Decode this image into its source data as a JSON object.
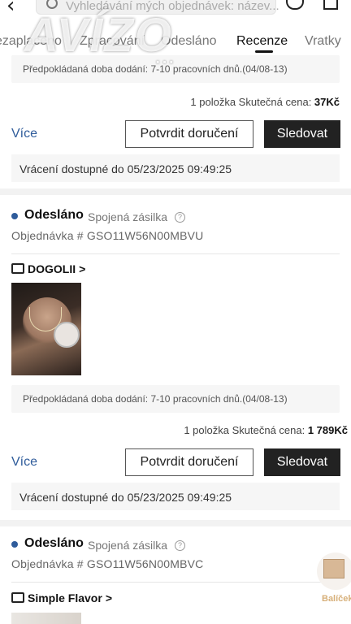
{
  "search": {
    "placeholder": "Vyhledávání mých objednávek: název..."
  },
  "watermark": {
    "text": "AVÍZO",
    "dots": "..."
  },
  "tabs": [
    {
      "label": "ezaplaceno"
    },
    {
      "label": "Zpracování"
    },
    {
      "label": "Odesláno"
    },
    {
      "label": "Recenze"
    },
    {
      "label": "Vratky"
    }
  ],
  "orders": [
    {
      "eta": "Předpokládaná doba dodání: 7-10 pracovních dnů.(04/08-13)",
      "summary_prefix": "1 položka Skutečná cena: ",
      "price": "37Kč",
      "more": "Více",
      "confirm": "Potvrdit doručení",
      "track": "Sledovat",
      "return_note": "Vrácení dostupné do 05/23/2025 09:49:25"
    },
    {
      "status": "Odesláno",
      "combined": "Spojená zásilka",
      "order_no": "Objednávka # GSO11W56N00MBVU",
      "store": "DOGOLII",
      "chevron": ">",
      "eta": "Předpokládaná doba dodání: 7-10 pracovních dnů.(04/08-13)",
      "summary_prefix": "1 položka Skutečná cena: ",
      "price": "1 789Kč",
      "more": "Více",
      "confirm": "Potvrdit doručení",
      "track": "Sledovat",
      "return_note": "Vrácení dostupné do 05/23/2025 09:49:25"
    },
    {
      "status": "Odesláno",
      "combined": "Spojená zásilka",
      "order_no": "Objednávka # GSO11W56N00MBVC",
      "store": "Simple Flavor",
      "chevron": ">"
    }
  ],
  "floating": {
    "label": "Balíček"
  },
  "icons": [
    "back-icon",
    "search-icon",
    "headset-icon",
    "bag-icon",
    "info-icon",
    "store-icon",
    "package-icon"
  ],
  "colors": {
    "accent_blue": "#2f5c9b",
    "button_dark": "#222222",
    "float_label": "#d7b07a"
  }
}
